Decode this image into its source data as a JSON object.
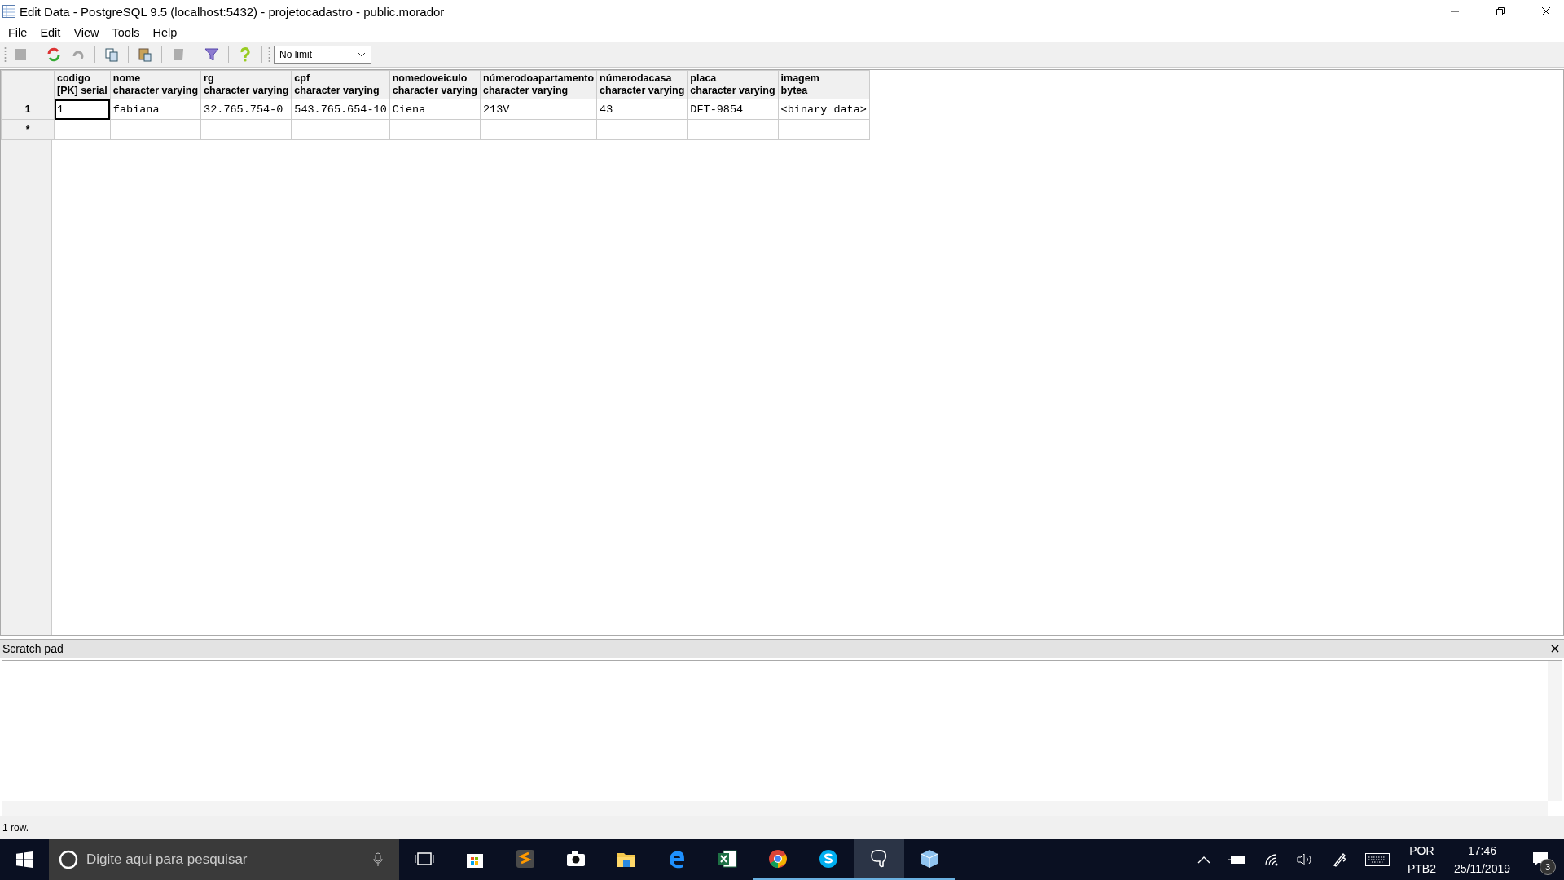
{
  "window": {
    "title": "Edit Data - PostgreSQL 9.5 (localhost:5432) - projetocadastro - public.morador"
  },
  "menu": [
    "File",
    "Edit",
    "View",
    "Tools",
    "Help"
  ],
  "toolbar": {
    "buttons": [
      {
        "kind": "save",
        "disabled": true
      },
      {
        "kind": "refresh",
        "disabled": false
      },
      {
        "kind": "undo",
        "disabled": true
      },
      {
        "kind": "copy",
        "disabled": false
      },
      {
        "kind": "paste",
        "disabled": false
      },
      {
        "kind": "delete",
        "disabled": true
      },
      {
        "kind": "filter",
        "disabled": false
      },
      {
        "kind": "help",
        "disabled": false
      }
    ],
    "limit": "No limit"
  },
  "grid": {
    "columns": [
      {
        "name": "codigo",
        "type": "[PK] serial"
      },
      {
        "name": "nome",
        "type": "character varying"
      },
      {
        "name": "rg",
        "type": "character varying"
      },
      {
        "name": "cpf",
        "type": "character varying"
      },
      {
        "name": "nomedoveiculo",
        "type": "character varying"
      },
      {
        "name": "númerodoapartamento",
        "type": "character varying"
      },
      {
        "name": "númerodacasa",
        "type": "character varying"
      },
      {
        "name": "placa",
        "type": "character varying"
      },
      {
        "name": "imagem",
        "type": "bytea"
      }
    ],
    "rows": [
      {
        "header": "1",
        "cells": [
          {
            "text": "1",
            "selected": true
          },
          {
            "text": "fabiana",
            "selected": false
          },
          {
            "text": "32.765.754-0",
            "selected": false
          },
          {
            "text": "543.765.654-10",
            "selected": false
          },
          {
            "text": "Ciena",
            "selected": false
          },
          {
            "text": "213V",
            "selected": false
          },
          {
            "text": "43",
            "selected": false
          },
          {
            "text": "DFT-9854",
            "selected": false
          },
          {
            "text": "<binary data>",
            "selected": false
          }
        ]
      }
    ],
    "new_row_marker": "*"
  },
  "scratch_pad": {
    "title": "Scratch pad"
  },
  "status_bar": "1 row.",
  "taskbar": {
    "search_placeholder": "Digite aqui para pesquisar",
    "apps": [
      {
        "kind": "taskview",
        "running": false,
        "selected": false
      },
      {
        "kind": "store",
        "running": false,
        "selected": false
      },
      {
        "kind": "sublime",
        "running": false,
        "selected": false
      },
      {
        "kind": "camera",
        "running": false,
        "selected": false
      },
      {
        "kind": "explorer",
        "running": false,
        "selected": false
      },
      {
        "kind": "edge",
        "running": false,
        "selected": false
      },
      {
        "kind": "excel",
        "running": false,
        "selected": false
      },
      {
        "kind": "chrome",
        "running": true,
        "selected": false
      },
      {
        "kind": "skype",
        "running": true,
        "selected": false
      },
      {
        "kind": "pgadmin",
        "running": true,
        "selected": true
      },
      {
        "kind": "cube",
        "running": true,
        "selected": false
      }
    ],
    "language": "POR",
    "layout": "PTB2",
    "time": "17:46",
    "date": "25/11/2019",
    "notifications": "3"
  }
}
